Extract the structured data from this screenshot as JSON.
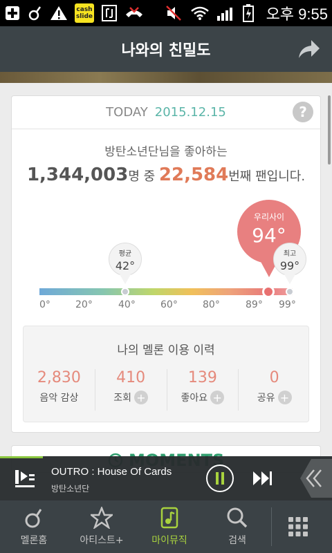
{
  "status_bar": {
    "cash_label": "cash slide",
    "ampm": "오후",
    "time": "9:55"
  },
  "header": {
    "title": "나와의 친밀도"
  },
  "card": {
    "today_label": "TODAY",
    "date": "2015.12.15",
    "help_label": "?",
    "fan_subtitle": "방탄소년단님을 좋아하는",
    "fan_total": "1,344,003",
    "fan_mid": "명 중",
    "fan_rank": "22,584",
    "fan_suffix": "번째 팬입니다."
  },
  "gauge": {
    "ticks": [
      "0°",
      "20°",
      "40°",
      "60°",
      "80°",
      "89°",
      "99°"
    ],
    "average": {
      "label": "평균",
      "value": "42°",
      "level": 42
    },
    "mine": {
      "label": "우리사이",
      "value": "94°",
      "level": 94
    },
    "max": {
      "label": "최고",
      "value": "99°",
      "level": 99
    }
  },
  "history": {
    "title": "나의 멜론 이용 이력",
    "items": [
      {
        "value": "2,830",
        "label": "음악 감상",
        "has_plus": false
      },
      {
        "value": "410",
        "label": "조회",
        "has_plus": true
      },
      {
        "value": "139",
        "label": "좋아요",
        "has_plus": true
      },
      {
        "value": "0",
        "label": "공유",
        "has_plus": true
      }
    ]
  },
  "moments": {
    "title": "MOMENTS"
  },
  "player": {
    "title": "OUTRO : House Of Cards",
    "artist": "방탄소년단",
    "progress": 0.13
  },
  "nav": {
    "items": [
      {
        "label": "멜론홈",
        "icon": "melon-home-icon"
      },
      {
        "label": "아티스트+",
        "icon": "star-icon"
      },
      {
        "label": "마이뮤직",
        "icon": "my-music-icon"
      },
      {
        "label": "검색",
        "icon": "search-icon"
      }
    ],
    "active_index": 2
  },
  "colors": {
    "accent_green": "#a8d23e",
    "date_teal": "#5bb5a8",
    "rank_orange": "#e07a58",
    "pin_red": "#e88080",
    "header_bg": "#3c4448"
  }
}
